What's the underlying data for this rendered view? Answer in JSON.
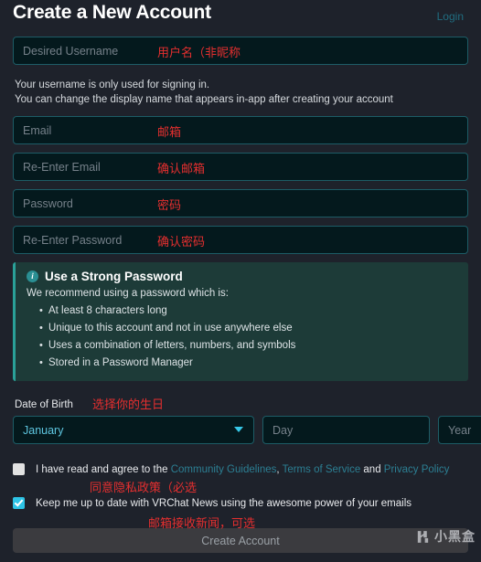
{
  "header": {
    "title": "Create a New Account",
    "login_label": "Login"
  },
  "fields": {
    "username": {
      "placeholder": "Desired Username",
      "annotation": "用户名（非昵称"
    },
    "email": {
      "placeholder": "Email",
      "annotation": "邮箱"
    },
    "email_confirm": {
      "placeholder": "Re-Enter Email",
      "annotation": "确认邮箱"
    },
    "password": {
      "placeholder": "Password",
      "annotation": "密码"
    },
    "password_confirm": {
      "placeholder": "Re-Enter Password",
      "annotation": "确认密码"
    }
  },
  "helper": {
    "line1": "Your username is only used for signing in.",
    "line2": "You can change the display name that appears in-app after creating your account"
  },
  "info_box": {
    "icon": "info-icon",
    "title": "Use a Strong Password",
    "subtitle": "We recommend using a password which is:",
    "bullets": [
      "At least 8 characters long",
      "Unique to this account and not in use anywhere else",
      "Uses a combination of letters, numbers, and symbols",
      "Stored in a Password Manager"
    ]
  },
  "date_of_birth": {
    "label": "Date of Birth",
    "annotation": "选择你的生日",
    "month_selected": "January",
    "day_placeholder": "Day",
    "year_placeholder": "Year"
  },
  "consent": {
    "tos": {
      "checked": false,
      "text_before": "I have read and agree to the ",
      "link1": "Community Guidelines",
      "sep1": ", ",
      "link2": "Terms of Service",
      "sep2": " and ",
      "link3": "Privacy Policy",
      "annotation": "同意隐私政策（必选"
    },
    "newsletter": {
      "checked": true,
      "text": "Keep me up to date with VRChat News using the awesome power of your emails",
      "annotation": "邮箱接收新闻，可选"
    }
  },
  "submit": {
    "label": "Create Account"
  },
  "watermark": {
    "text": "小黑盒"
  },
  "colors": {
    "page_background": "#1e222b",
    "field_background": "#04191d",
    "field_border": "#1d5c66",
    "accent_teal": "#2aa198",
    "link_teal": "#2c7f93",
    "annotation_red": "#e52f2f",
    "checkbox_checked": "#2ec4e6",
    "info_box_background": "#1d3b38",
    "submit_background": "#3b3b3f"
  }
}
